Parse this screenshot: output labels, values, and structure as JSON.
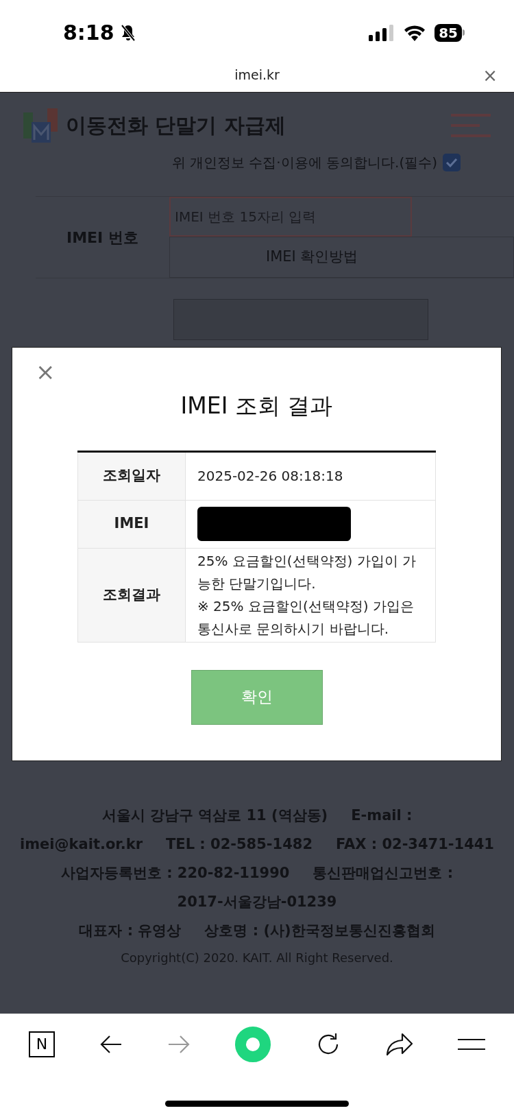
{
  "status_bar": {
    "time": "8:18",
    "battery": "85"
  },
  "browser": {
    "url": "imei.kr",
    "close": "×"
  },
  "page": {
    "site_title": "이동전화 단말기 자급제",
    "consent": {
      "label": "위 개인정보 수집·이용에 동의합니다.(필수)",
      "checked": true
    },
    "imei_label": "IMEI 번호",
    "imei_placeholder": "IMEI 번호 15자리 입력",
    "help_button": "IMEI 확인방법"
  },
  "modal": {
    "close": "×",
    "title": "IMEI 조회 결과",
    "rows": [
      {
        "label": "조회일자",
        "value": "2025-02-26 08:18:18"
      },
      {
        "label": "IMEI",
        "kind": "redacted"
      },
      {
        "label": "조회결과",
        "value": "25% 요금할인(선택약정) 가입이 가능한 단말기입니다.\n※ 25% 요금할인(선택약정) 가입은 통신사로 문의하시기 바랍니다."
      }
    ],
    "confirm": "확인"
  },
  "footer": {
    "lines": [
      [
        "서울시 강남구 역삼로 11 (역삼동)",
        "E-mail :"
      ],
      [
        "imei@kait.or.kr",
        "TEL : 02-585-1482",
        "FAX : 02-3471-1441"
      ],
      [
        "사업자등록번호 : 220-82-11990",
        "통신판매업신고번호 :"
      ],
      [
        "2017-서울강남-01239"
      ],
      [
        "대표자 : 유영상",
        "상호명 : (사)한국정보통신진흥협회"
      ]
    ],
    "copyright": "Copyright(C) 2020. KAIT. All Right Reserved."
  },
  "toolbar": {
    "home_letter": "N",
    "forward_disabled": true
  }
}
